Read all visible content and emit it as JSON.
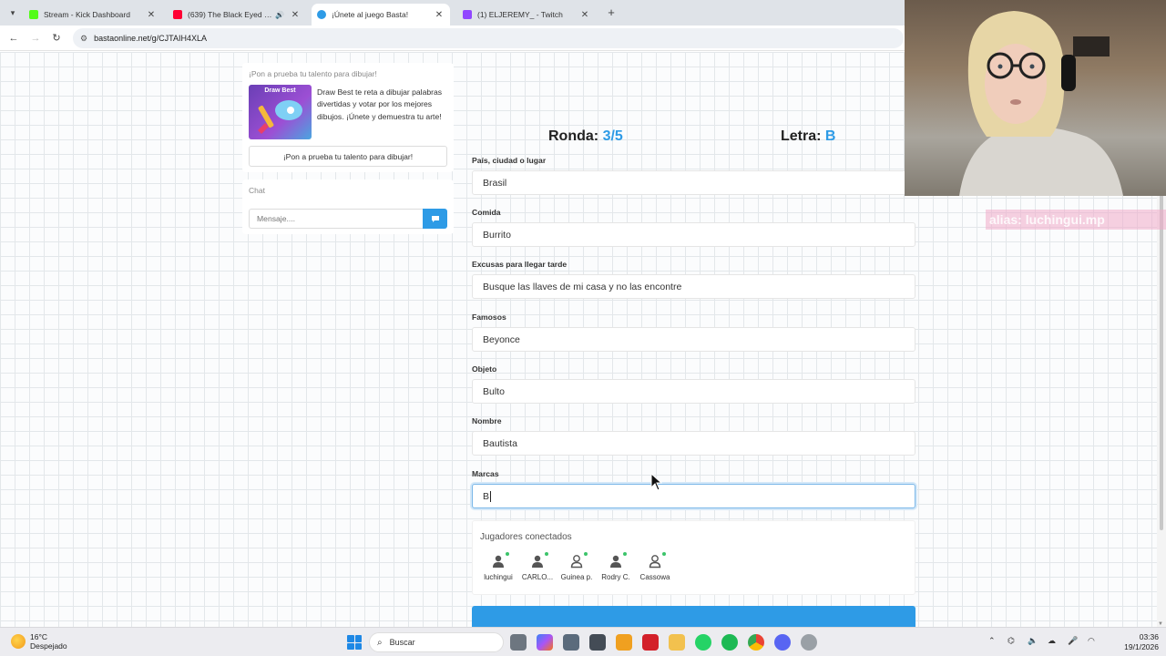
{
  "browser": {
    "tabs": [
      {
        "title": "Stream - Kick Dashboard",
        "color": "#53fc18",
        "active": false,
        "audio": false
      },
      {
        "title": "(639) The Black Eyed Peas",
        "color": "#ff0033",
        "active": false,
        "audio": true
      },
      {
        "title": "¡Únete al juego Basta!",
        "color": "#2e9be6",
        "active": true,
        "audio": false
      },
      {
        "title": "(1) ELJEREMY_ - Twitch",
        "color": "#9146ff",
        "active": false,
        "audio": false
      }
    ],
    "url": "bastaonline.net/g/CJTAIH4XLA"
  },
  "promo": {
    "heading": "¡Pon a prueba tu talento para dibujar!",
    "image_brand": "Draw Best",
    "text": "Draw Best te reta a dibujar palabras divertidas y votar por los mejores dibujos. ¡Únete y demuestra tu arte!",
    "button": "¡Pon a prueba tu talento para dibujar!"
  },
  "chat": {
    "heading": "Chat",
    "placeholder": "Mensaje...."
  },
  "game": {
    "round_label": "Ronda:",
    "round_value": "3/5",
    "letter_label": "Letra:",
    "letter_value": "B",
    "fields": [
      {
        "label": "País, ciudad o lugar",
        "value": "Brasil"
      },
      {
        "label": "Comida",
        "value": "Burrito"
      },
      {
        "label": "Excusas para llegar tarde",
        "value": "Busque las llaves de mi casa y no las encontre"
      },
      {
        "label": "Famosos",
        "value": "Beyonce"
      },
      {
        "label": "Objeto",
        "value": "Bulto"
      },
      {
        "label": "Nombre",
        "value": "Bautista"
      },
      {
        "label": "Marcas",
        "value": "B"
      }
    ],
    "accent": "#2e9be6"
  },
  "players": {
    "heading": "Jugadores conectados",
    "list": [
      "luchingui",
      "CARLO...",
      "Guinea p.",
      "Rodry C.",
      "Cassowa"
    ]
  },
  "overlay": {
    "alias": "alias: luchingui.mp"
  },
  "taskbar": {
    "temperature": "16°C",
    "condition": "Despejado",
    "search_label": "Buscar",
    "time": "03:36",
    "date": "19/1/2026"
  }
}
